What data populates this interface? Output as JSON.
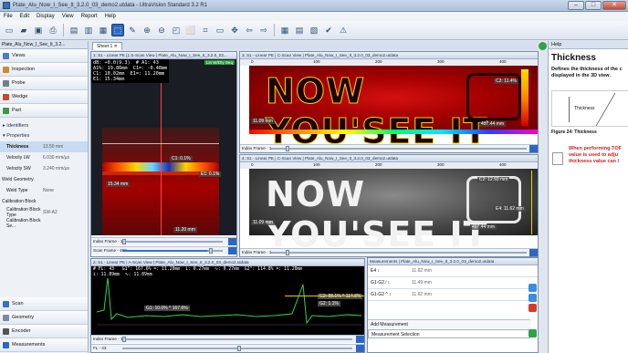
{
  "window": {
    "title": "Plate_Alu_Now_I_See_It_3.2.0_03_demo2.utdata - UltraVision Standard 3.2 R1",
    "min": "–",
    "max": "□",
    "close": "✕"
  },
  "menu": [
    "File",
    "Edit",
    "Display",
    "View",
    "Report",
    "Help"
  ],
  "left": {
    "title": "Plate_Alu_Now_I_See_It_3.2...",
    "nav_top": [
      "Views",
      "Inspection",
      "Probe",
      "Wedge",
      "Part"
    ],
    "identifiers": "Identifiers",
    "properties": "Properties",
    "props": [
      {
        "k": "Thickness",
        "v": "13.50 mm"
      },
      {
        "k": "Velocity LW",
        "v": "6.030 mm/μs"
      },
      {
        "k": "Velocity SW",
        "v": "3.240 mm/μs"
      },
      {
        "k": "Weld Geometry",
        "v": ""
      },
      {
        "k": "Weld Type",
        "v": "None"
      },
      {
        "k": "Calibration Block",
        "v": ""
      },
      {
        "k": "Calibration Block Type",
        "v": "SW-A2"
      },
      {
        "k": "Calibration Block Se...",
        "v": ""
      }
    ],
    "nav_bottom": [
      "Scan",
      "Geometry",
      "Encoder",
      "Measurements"
    ]
  },
  "tab": "Sheet 1",
  "views": {
    "sscan": {
      "title": "1: S1 - Linear PE [1:S-Scan View | Plate_Alu_Now_I_See_It_3.2.0_03...",
      "readout": "dB: +0.0(9.3)  # A1: 43\nA1%: 19.86mm  C1=: -0.48mm\nC1: 10.02mm  E1=: 11.20mm\nE1: 15.34mm",
      "badge": "Lin W/Dly Seq",
      "c1": "C1: 0.1%",
      "e1": "E1: 0.1%",
      "depth": "15.34 mm",
      "bottom": "11.20 mm",
      "frame": "Index Frame - 1",
      "scan": "Scan Frame - 498"
    },
    "cscan1": {
      "title": "3: S1 - Linear PE | C-Scan View | Plate_Alu_Now_I_See_It_3.2.0_03_demo2.utdata",
      "text": "NOW YOU'SEE IT",
      "left": "11.09 mm",
      "right": "497.44 mm",
      "c2": "C2: 11.4%",
      "frame": "Index Frame - 1",
      "ticks": [
        "0",
        "100",
        "200",
        "300",
        "400"
      ]
    },
    "cscan2": {
      "title": "4: S1 - Linear PE | C-Scan View | Plate_Alu_Now_I_See_It_3.2.0_03_demo2.utdata",
      "text": "NOW YOU'SEE IT",
      "left": "11.09 mm",
      "right": "497.44 mm",
      "c2": "C2: 12.93 mm",
      "e4": "E4: 11.62 mm",
      "frame": "Index Frame - 1",
      "ticks": [
        "0",
        "100",
        "200",
        "300",
        "400"
      ]
    },
    "ascan": {
      "title": "2: S1 - Linear PE | A-Scan View | Plate_Alu_Now_I_See_It_3.2.0_03_demo2.utdata",
      "readout": "# FL: 43   G1^: 167.6% =: 11.20mm  i: 0.27mm  ∿: 0.27mm  G2^: 114.8% =: 11.20mm\ni: 11.89mm  ∿: 11.89mm",
      "g1": "G1: 10.0% ^ 167.6%",
      "g2": "G2: 88.1% ^ 114.8%",
      "g2b": "G2: 1.1%",
      "frame": "Index Frame - 1",
      "fl": "FL - 43"
    }
  },
  "measurements": {
    "title": "Measurements | Plate_Alu_Now_I_See_It_3.2.0_03_demo2.utdata",
    "rows": [
      {
        "k": "E4 ↕",
        "v": "11.62 mm"
      },
      {
        "k": "G1-G2 ∕ ↕",
        "v": "11.49 mm"
      },
      {
        "k": "G1-G2 ^ ↕",
        "v": "11.62 mm"
      }
    ],
    "add": "Add Measurement",
    "selection": "Measurement Selection"
  },
  "help": {
    "head": "Help",
    "title": "Thickness",
    "desc": "Defines the thickness of the c\ndisplayed in the 3D view.",
    "fig_label": "Thickness",
    "caption": "Figure 24: Thickness",
    "warning": "When performing TOF\nvalue is used to adju\nthickness value can l"
  }
}
